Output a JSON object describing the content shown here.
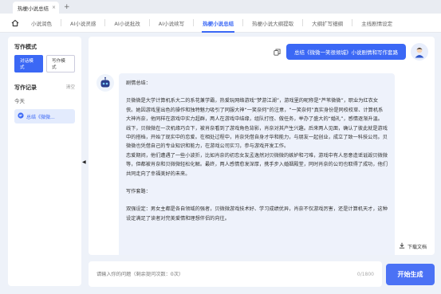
{
  "window": {
    "tab_title": "热梗小说总结",
    "close_glyph": "×",
    "add_glyph": "+"
  },
  "nav": {
    "tabs": [
      {
        "label": "小说润色"
      },
      {
        "label": "AI小说灵感"
      },
      {
        "label": "AI小说批改"
      },
      {
        "label": "AI小说续写"
      },
      {
        "label": "热梗小说总结"
      },
      {
        "label": "热梗小说大纲提取"
      },
      {
        "label": "大纲扩写细纲"
      },
      {
        "label": "主线剧情设定"
      }
    ],
    "active_index": 4
  },
  "sidebar": {
    "mode_title": "写作模式",
    "modes": [
      "对话模式",
      "写作模式"
    ],
    "active_mode": 0,
    "records_title": "写作记录",
    "clear_label": "清空",
    "today_label": "今天",
    "records": [
      {
        "label": "总结《微微..."
      }
    ]
  },
  "chat": {
    "user_message": "总结《微微一笑很倾城》小说剧情和写作套路",
    "bot_paragraphs": [
      "剧情总结：",
      "",
      "贝微微是大学计算机系大二的系花兼学霸，热爱玩网络游戏“梦游江湖”，游戏里的昵称是“芦苇微微”，职业为红衣女侠。她因游戏里出色的操作和独特魅力吸引了同服大神“一笑奈何”的注意，“一笑奈何”真实身份是同校校草、计算机系大神肖奈，他同样在游戏中实力超群，两人在游戏中结缘，组队打怪、做任务，举办了盛大的“婚礼”，感情逐渐升温。",
      "线下，贝微微在一次机缘巧合下，被肖奈看到了游戏角色背影，肖奈对其产生兴趣。后来两人见面，确认了彼此就是游戏中的搭档，开始了现实中的恋爱。在相处过程中，肖奈凭借自身才华和能力，与朋友一起创业，成立了致一科技公司。贝微微也凭借自己的专业知识和能力，在游戏公司实习，参与游戏开发工作。",
      "恋爱期间，他们遭遇了一些小波折，比如肖奈的初恋女友孟逸然对贝微微的嫉妒和刁难，游戏中有人恶意造谣诋毁贝微微等，但都被肖奈和贝微微轻松化解。最终，两人感情愈发深厚，携手步入婚姻殿堂，同时肖奈的公司也取得了成功，他们共同走向了幸福美好的未来。",
      "",
      "写作套路：",
      "",
      "双强设定：男女主都是各自领域的强者，贝微微游戏技术好、学习成绩优异，肖奈不仅游戏厉害，还是计算机天才，这种设定满足了读者对完美爱情和理想伴侣的向往。"
    ],
    "download_label": "下载文档"
  },
  "input": {
    "placeholder": "请输入你的问题（剩余提问次数：0次）",
    "counter": "0/1800"
  },
  "generate_label": "开始生成",
  "colors": {
    "accent": "#3b68f5",
    "panel_bg": "#eef2fb",
    "page_bg": "#eef2f9"
  },
  "icons": [
    "home-icon",
    "copy-icon",
    "user-avatar-icon",
    "robot-icon",
    "chat-bubble-icon",
    "download-icon",
    "collapse-arrow-icon"
  ]
}
